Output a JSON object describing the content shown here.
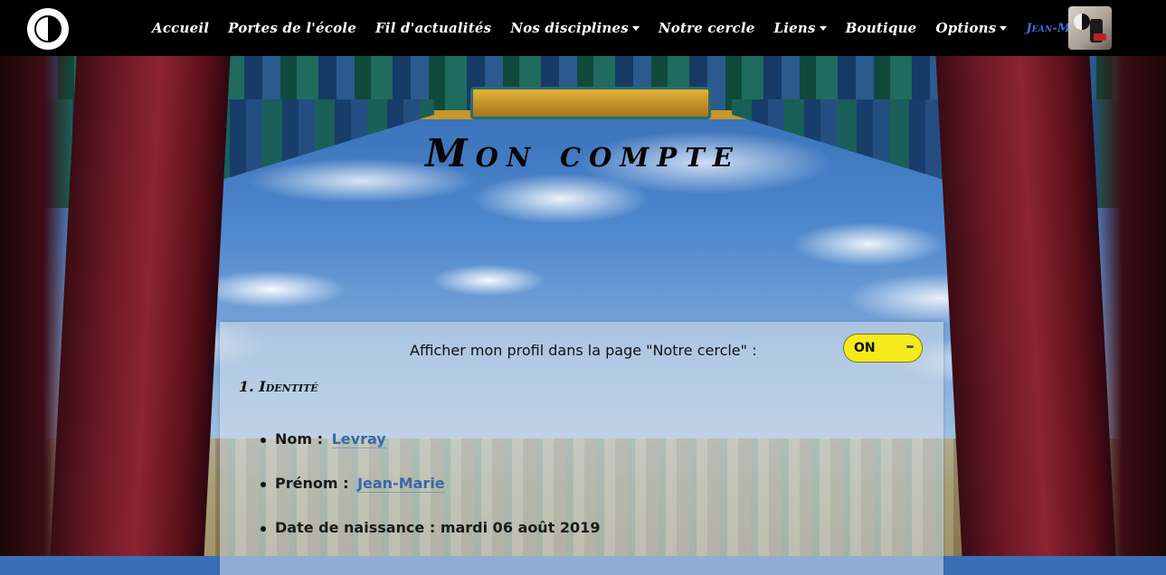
{
  "nav": {
    "items": [
      {
        "label": "Accueil",
        "dropdown": false
      },
      {
        "label": "Portes de l'école",
        "dropdown": false
      },
      {
        "label": "Fil d'actualités",
        "dropdown": false
      },
      {
        "label": "Nos disciplines",
        "dropdown": true
      },
      {
        "label": "Notre cercle",
        "dropdown": false
      },
      {
        "label": "Liens",
        "dropdown": true
      },
      {
        "label": "Boutique",
        "dropdown": false
      },
      {
        "label": "Options",
        "dropdown": true
      }
    ],
    "user": "Jean-Marie"
  },
  "page": {
    "title": "Mon compte"
  },
  "profile": {
    "show_label": "Afficher mon profil dans la page \"Notre cercle\" :",
    "toggle_value": "ON"
  },
  "identity": {
    "title": "1. Identité",
    "fields": [
      {
        "label": "Nom :",
        "value": "Levray"
      },
      {
        "label": "Prénom :",
        "value": "Jean-Marie"
      },
      {
        "label": "Date de naissance :",
        "value": "mardi 06 août 2019"
      }
    ]
  }
}
